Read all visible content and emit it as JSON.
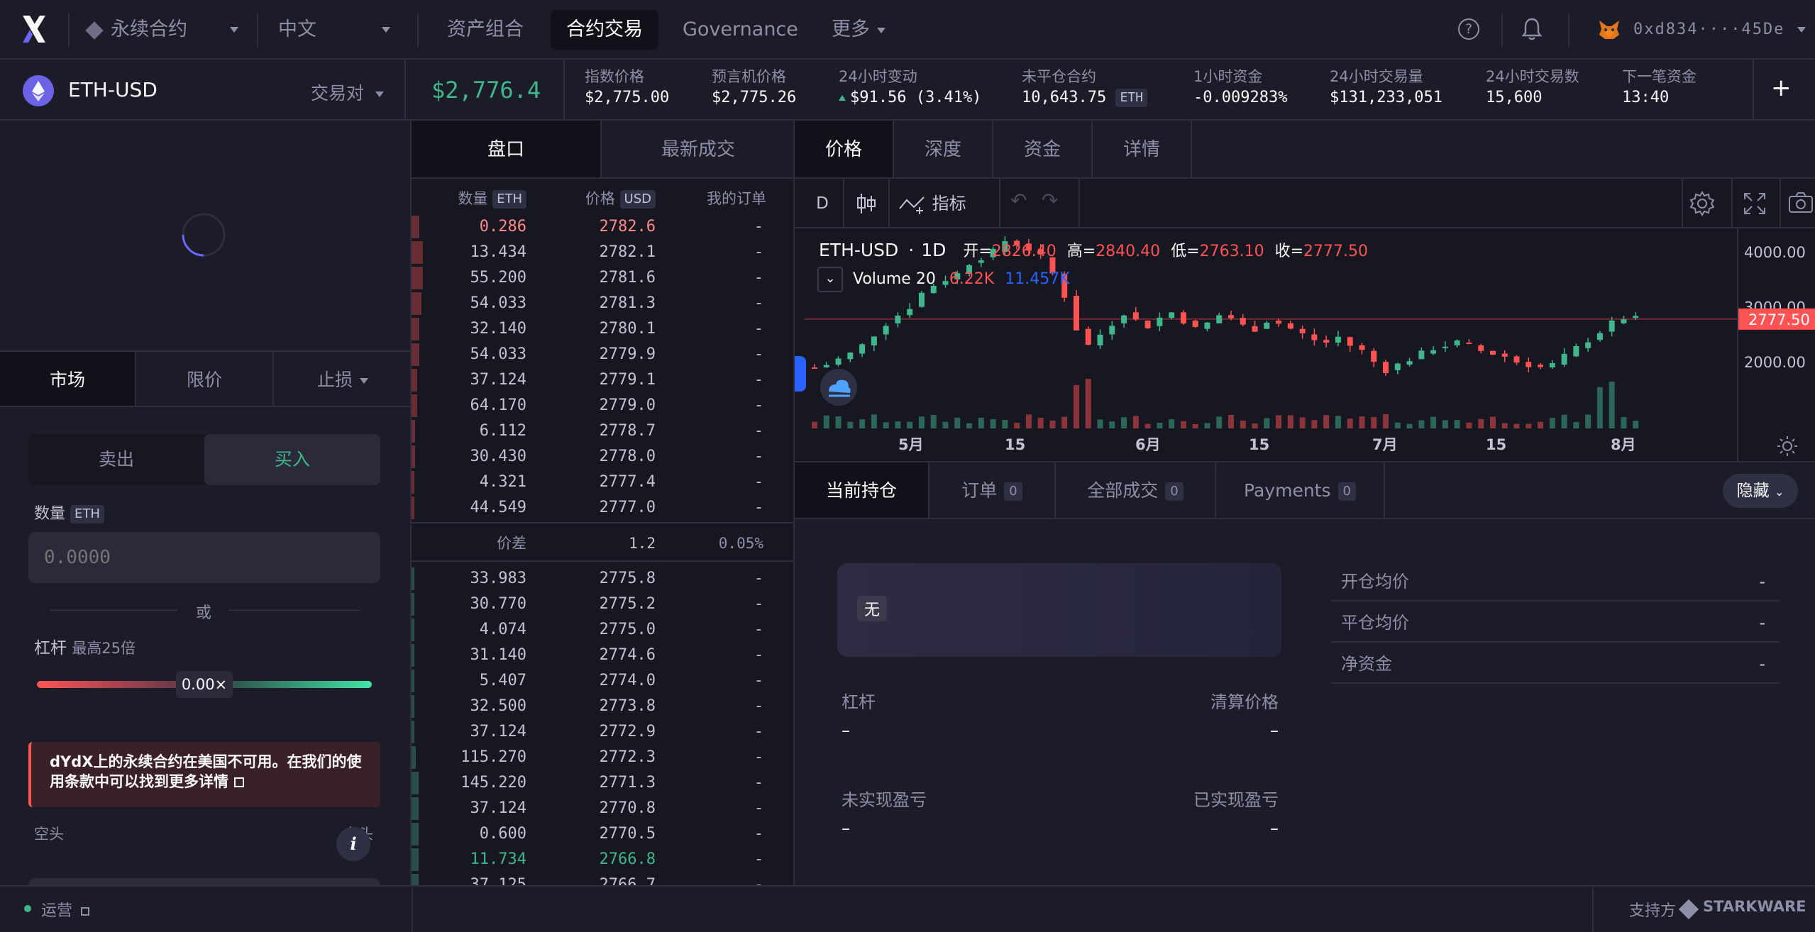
{
  "nav": {
    "market_type": "永续合约",
    "language": "中文",
    "tabs": [
      "资产组合",
      "合约交易",
      "Governance",
      "更多"
    ],
    "wallet": "0xd834····45De"
  },
  "market": {
    "pair": "ETH-USD",
    "pair_selector": "交易对",
    "price": "$2,776.4",
    "stats": [
      {
        "label": "指数价格",
        "value": "$2,775.00"
      },
      {
        "label": "预言机价格",
        "value": "$2,775.26"
      },
      {
        "label": "24小时变动",
        "value": "$91.56 (3.41%)"
      },
      {
        "label": "未平仓合约",
        "value": "10,643.75",
        "unit": "ETH"
      },
      {
        "label": "1小时资金",
        "value": "-0.009283%"
      },
      {
        "label": "24小时交易量",
        "value": "$131,233,051"
      },
      {
        "label": "24小时交易数",
        "value": "15,600"
      },
      {
        "label": "下一笔资金",
        "value": "13:40"
      }
    ],
    "add_label": "+"
  },
  "trade": {
    "order_types": [
      "市场",
      "限价",
      "止损"
    ],
    "sides": [
      "卖出",
      "买入"
    ],
    "amount_label": "数量",
    "amount_unit": "ETH",
    "amount_placeholder": "0.0000",
    "or_label": "或",
    "leverage_label": "杠杆",
    "leverage_max": "最高25倍",
    "leverage_value": "0.00×",
    "short_label": "空头",
    "long_label": "多头",
    "warning": "dYdX上的永续合约在美国不可用。在我们的使用条款中可以找到更多详情",
    "info_icon": "i"
  },
  "orderbook": {
    "tabs": [
      "盘口",
      "最新成交"
    ],
    "headers": {
      "size": "数量",
      "size_unit": "ETH",
      "price": "价格",
      "price_unit": "USD",
      "mine": "我的订单"
    },
    "asks": [
      {
        "size": "0.286",
        "price": "2782.6",
        "mine": "-",
        "depth": 0.02
      },
      {
        "size": "13.434",
        "price": "2782.1",
        "mine": "-",
        "depth": 0.03
      },
      {
        "size": "55.200",
        "price": "2781.6",
        "mine": "-",
        "depth": 0.03
      },
      {
        "size": "54.033",
        "price": "2781.3",
        "mine": "-",
        "depth": 0.025
      },
      {
        "size": "32.140",
        "price": "2780.1",
        "mine": "-",
        "depth": 0.02
      },
      {
        "size": "54.033",
        "price": "2779.9",
        "mine": "-",
        "depth": 0.02
      },
      {
        "size": "37.124",
        "price": "2779.1",
        "mine": "-",
        "depth": 0.015
      },
      {
        "size": "64.170",
        "price": "2779.0",
        "mine": "-",
        "depth": 0.015
      },
      {
        "size": "6.112",
        "price": "2778.7",
        "mine": "-",
        "depth": 0.01
      },
      {
        "size": "30.430",
        "price": "2778.0",
        "mine": "-",
        "depth": 0.01
      },
      {
        "size": "4.321",
        "price": "2777.4",
        "mine": "-",
        "depth": 0.005
      },
      {
        "size": "44.549",
        "price": "2777.0",
        "mine": "-",
        "depth": 0.005
      }
    ],
    "spread": {
      "label": "价差",
      "value": "1.2",
      "pct": "0.05%"
    },
    "bids": [
      {
        "size": "33.983",
        "price": "2775.8",
        "mine": "-",
        "depth": 0.005
      },
      {
        "size": "30.770",
        "price": "2775.2",
        "mine": "-",
        "depth": 0.005
      },
      {
        "size": "4.074",
        "price": "2775.0",
        "mine": "-",
        "depth": 0.005
      },
      {
        "size": "31.140",
        "price": "2774.6",
        "mine": "-",
        "depth": 0.005
      },
      {
        "size": "5.407",
        "price": "2774.0",
        "mine": "-",
        "depth": 0.005
      },
      {
        "size": "32.500",
        "price": "2773.8",
        "mine": "-",
        "depth": 0.005
      },
      {
        "size": "37.124",
        "price": "2772.9",
        "mine": "-",
        "depth": 0.008
      },
      {
        "size": "115.270",
        "price": "2772.3",
        "mine": "-",
        "depth": 0.012
      },
      {
        "size": "145.220",
        "price": "2771.3",
        "mine": "-",
        "depth": 0.018
      },
      {
        "size": "37.124",
        "price": "2770.8",
        "mine": "-",
        "depth": 0.018
      },
      {
        "size": "0.600",
        "price": "2770.5",
        "mine": "-",
        "depth": 0.018
      },
      {
        "size": "11.734",
        "price": "2766.8",
        "mine": "-",
        "depth": 0.018
      },
      {
        "size": "37.125",
        "price": "2766.7",
        "mine": "-",
        "depth": 0.018
      }
    ]
  },
  "chart": {
    "tabs": [
      "价格",
      "深度",
      "资金",
      "详情"
    ],
    "interval": "D",
    "indicators_label": "指标",
    "symbol": "ETH-USD",
    "resolution": "1D",
    "ohlc": {
      "open_label": "开=",
      "open": "2826.40",
      "high_label": "高=",
      "high": "2840.40",
      "low_label": "低=",
      "low": "2763.10",
      "close_label": "收=",
      "close": "2777.50"
    },
    "volume_label": "Volume 20",
    "volume_a": "6.22K",
    "volume_b": "11.457K",
    "y_ticks": [
      "4000.00",
      "3000.00",
      "2000.00"
    ],
    "x_ticks": [
      "5月",
      "15",
      "6月",
      "15",
      "7月",
      "15",
      "8月"
    ],
    "last_price_tag": "2777.50"
  },
  "positions": {
    "tabs": [
      {
        "label": "当前持仓",
        "count": null
      },
      {
        "label": "订单",
        "count": "0"
      },
      {
        "label": "全部成交",
        "count": "0"
      },
      {
        "label": "Payments",
        "count": "0"
      }
    ],
    "hide_label": "隐藏",
    "empty_badge": "无",
    "fields": [
      {
        "label": "杠杆",
        "value": "–"
      },
      {
        "label": "清算价格",
        "value": "–"
      },
      {
        "label": "未实现盈亏",
        "value": "–"
      },
      {
        "label": "已实现盈亏",
        "value": "–"
      }
    ],
    "right_fields": [
      {
        "label": "开仓均价",
        "value": "-"
      },
      {
        "label": "平仓均价",
        "value": "-"
      },
      {
        "label": "净资金",
        "value": "-"
      }
    ]
  },
  "footer": {
    "status": "运营",
    "supported_by": "支持方",
    "brand": "STARKWARE"
  },
  "colors": {
    "green": "#3fb68b",
    "red": "#ff5353",
    "accent": "#5973fe"
  }
}
